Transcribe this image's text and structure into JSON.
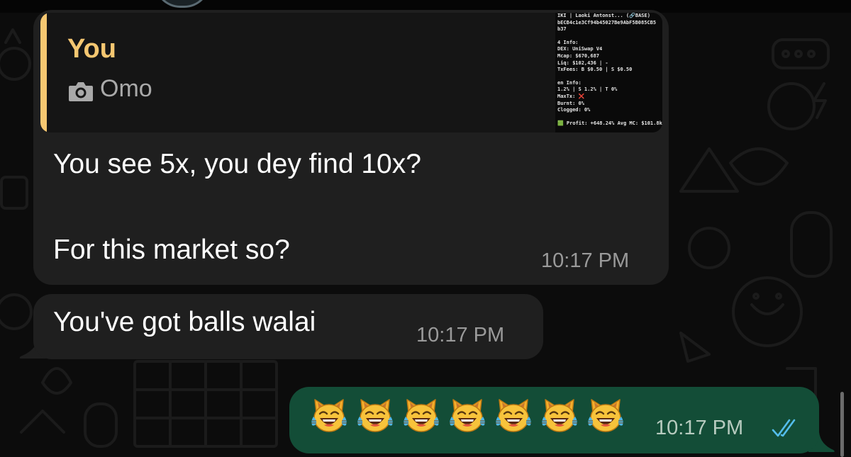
{
  "colors": {
    "background": "#0c0c0c",
    "incoming_bubble": "#1f1f1f",
    "outgoing_bubble": "#134d37",
    "quote_accent": "#f5c771",
    "timestamp": "#9a9a9a",
    "read_ticks": "#53bdeb"
  },
  "messages": [
    {
      "reply": {
        "author": "You",
        "media_icon": "camera-icon",
        "text": "Omo",
        "thumbnail_lines": [
          "IKI | Laoki Antonst... (🔗BASE)",
          "bECB4c1e3Cf94b45027Be9AbF5B085CB5",
          "b37",
          "",
          "4 Info:",
          "DEX: UniSwap V4",
          "Mcap: $670,687",
          "Liq: $102,436 | -",
          "TxFees: B $0.50 | S $0.50",
          "",
          "en Info:",
          "1.2% | S 1.2% | T 0%",
          "MaxTx: ❌",
          "Burnt: 0%",
          "Clogged: 0%",
          "",
          "🟩 Profit: +648.24% Avg MC: $101.8k"
        ]
      },
      "line1": "You see 5x, you dey find 10x?",
      "line2": "For this market so?",
      "time": "10:17 PM"
    },
    {
      "text": "You've got balls walai",
      "time": "10:17 PM"
    },
    {
      "emoji_name": "cat-with-tears-of-joy-icon",
      "emoji_count": 7,
      "time": "10:17 PM",
      "status_icon": "double-check-read-icon"
    }
  ]
}
